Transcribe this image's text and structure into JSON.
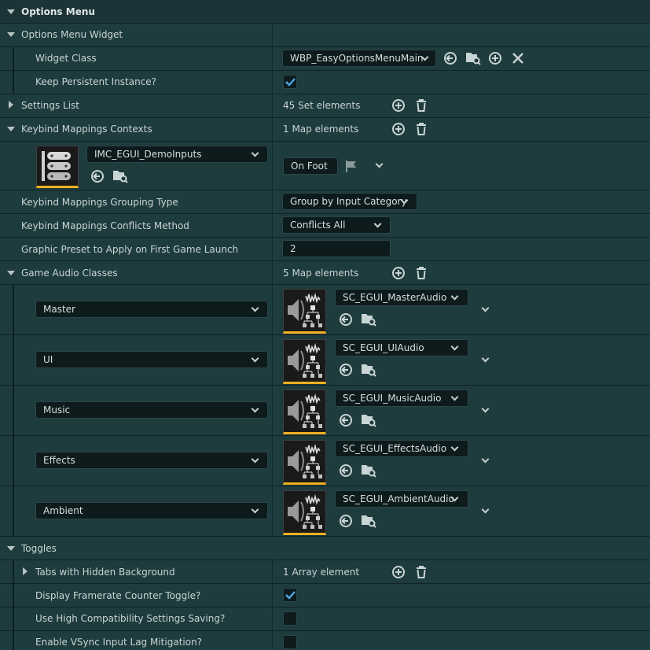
{
  "sections": {
    "options_menu": "Options Menu",
    "options_menu_widget": "Options Menu Widget",
    "widget_class_label": "Widget Class",
    "widget_class_value": "WBP_EasyOptionsMenuMain",
    "keep_persistent_label": "Keep Persistent Instance?",
    "keep_persistent_checked": true,
    "settings_list_label": "Settings List",
    "settings_list_value": "45 Set elements",
    "keybind_contexts_label": "Keybind Mappings Contexts",
    "keybind_contexts_value": "1 Map elements",
    "keybind_asset": "IMC_EGUI_DemoInputs",
    "keybind_value": "On Foot",
    "grouping_label": "Keybind Mappings Grouping Type",
    "grouping_value": "Group by Input Category",
    "conflicts_label": "Keybind Mappings Conflicts Method",
    "conflicts_value": "Conflicts All",
    "graphic_preset_label": "Graphic Preset to Apply on First Game Launch",
    "graphic_preset_value": "2",
    "audio_classes_label": "Game Audio Classes",
    "audio_classes_value": "5 Map elements",
    "toggles_label": "Toggles",
    "tabs_hidden_label": "Tabs with Hidden Background",
    "tabs_hidden_value": "1 Array element",
    "framerate_label": "Display Framerate Counter Toggle?",
    "framerate_checked": true,
    "high_compat_label": "Use High Compatibility Settings Saving?",
    "high_compat_checked": false,
    "vsync_label": "Enable VSync Input Lag Mitigation?",
    "vsync_checked": false
  },
  "audio_entries": [
    {
      "key": "Master",
      "asset": "SC_EGUI_MasterAudio"
    },
    {
      "key": "UI",
      "asset": "SC_EGUI_UIAudio"
    },
    {
      "key": "Music",
      "asset": "SC_EGUI_MusicAudio"
    },
    {
      "key": "Effects",
      "asset": "SC_EGUI_EffectsAudio"
    },
    {
      "key": "Ambient",
      "asset": "SC_EGUI_AmbientAudio"
    }
  ],
  "icons": {
    "expand": "triangle-down-icon",
    "collapse": "triangle-right-icon",
    "browse": "browse-arrow-icon",
    "find": "folder-search-icon",
    "add": "plus-circle-icon",
    "clear": "x-icon",
    "remove": "trash-icon",
    "check": "checkmark-icon",
    "flag": "flag-icon"
  },
  "colors": {
    "background": "#1e3b3e",
    "header": "#1c3437",
    "field": "#0d1b1d",
    "check": "#4aa8e8",
    "thumb_accent": "#f0b020"
  }
}
